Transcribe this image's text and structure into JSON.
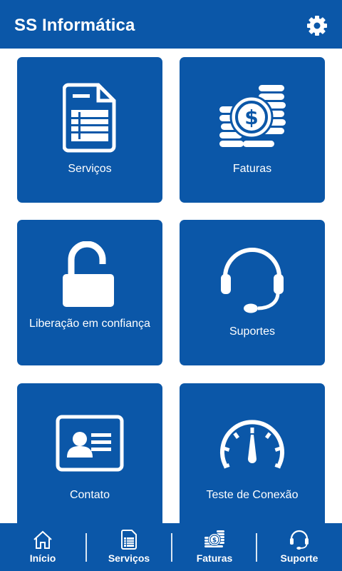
{
  "header": {
    "title": "SS Informática"
  },
  "tiles": [
    {
      "label": "Serviços"
    },
    {
      "label": "Faturas"
    },
    {
      "label": "Liberação em confiança"
    },
    {
      "label": "Suportes"
    },
    {
      "label": "Contato"
    },
    {
      "label": "Teste de Conexão"
    }
  ],
  "bottom_nav": [
    {
      "label": "Início"
    },
    {
      "label": "Serviços"
    },
    {
      "label": "Faturas"
    },
    {
      "label": "Suporte"
    }
  ],
  "colors": {
    "primary": "#0b57a8",
    "on_primary": "#ffffff"
  }
}
